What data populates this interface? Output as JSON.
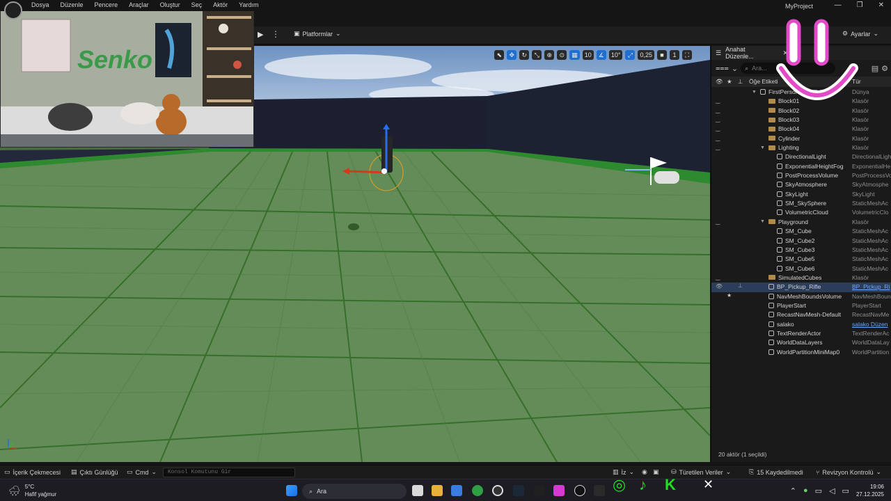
{
  "app": {
    "project_name": "MyProject",
    "window_controls": [
      "—",
      "❐",
      "✕"
    ]
  },
  "menu": {
    "items": [
      "Dosya",
      "Düzenle",
      "Pencere",
      "Araçlar",
      "Oluştur",
      "Seç",
      "Aktör",
      "Yardım"
    ]
  },
  "toolbar": {
    "platforms_label": "Platformlar",
    "settings_label": "Ayarlar"
  },
  "viewport": {
    "grid_snap": "10",
    "rotation_snap": "10°",
    "scale_snap": "0,25",
    "camera_speed": "1"
  },
  "outliner": {
    "tab_title": "Anahat Düzenle...",
    "search_placeholder": "Ara...",
    "header_label": "Öğe Etiketi",
    "header_type": "Tür",
    "rows": [
      {
        "label": "FirstPersonMap (Editör)",
        "type": "Dünya",
        "indent": 0,
        "kind": "world",
        "caret": "▼"
      },
      {
        "label": "Block01",
        "type": "Klasör",
        "indent": 1,
        "kind": "folder",
        "caret": ""
      },
      {
        "label": "Block02",
        "type": "Klasör",
        "indent": 1,
        "kind": "folder",
        "caret": ""
      },
      {
        "label": "Block03",
        "type": "Klasör",
        "indent": 1,
        "kind": "folder",
        "caret": ""
      },
      {
        "label": "Block04",
        "type": "Klasör",
        "indent": 1,
        "kind": "folder",
        "caret": ""
      },
      {
        "label": "Cylinder",
        "type": "Klasör",
        "indent": 1,
        "kind": "folder",
        "caret": ""
      },
      {
        "label": "Lighting",
        "type": "Klasör",
        "indent": 1,
        "kind": "folder",
        "caret": "▼"
      },
      {
        "label": "DirectionalLight",
        "type": "DirectionalLight",
        "indent": 2,
        "kind": "actor",
        "caret": ""
      },
      {
        "label": "ExponentialHeightFog",
        "type": "ExponentialHe",
        "indent": 2,
        "kind": "actor",
        "caret": ""
      },
      {
        "label": "PostProcessVolume",
        "type": "PostProcessVo",
        "indent": 2,
        "kind": "actor",
        "caret": ""
      },
      {
        "label": "SkyAtmosphere",
        "type": "SkyAtmosphe",
        "indent": 2,
        "kind": "actor",
        "caret": ""
      },
      {
        "label": "SkyLight",
        "type": "SkyLight",
        "indent": 2,
        "kind": "actor",
        "caret": ""
      },
      {
        "label": "SM_SkySphere",
        "type": "StaticMeshAc",
        "indent": 2,
        "kind": "actor",
        "caret": ""
      },
      {
        "label": "VolumetricCloud",
        "type": "VolumetricClo",
        "indent": 2,
        "kind": "actor",
        "caret": ""
      },
      {
        "label": "Playground",
        "type": "Klasör",
        "indent": 1,
        "kind": "folder",
        "caret": "▼"
      },
      {
        "label": "SM_Cube",
        "type": "StaticMeshAc",
        "indent": 2,
        "kind": "actor",
        "caret": ""
      },
      {
        "label": "SM_Cube2",
        "type": "StaticMeshAc",
        "indent": 2,
        "kind": "actor",
        "caret": ""
      },
      {
        "label": "SM_Cube3",
        "type": "StaticMeshAc",
        "indent": 2,
        "kind": "actor",
        "caret": ""
      },
      {
        "label": "SM_Cube5",
        "type": "StaticMeshAc",
        "indent": 2,
        "kind": "actor",
        "caret": ""
      },
      {
        "label": "SM_Cube6",
        "type": "StaticMeshAc",
        "indent": 2,
        "kind": "actor",
        "caret": ""
      },
      {
        "label": "SimulatedCubes",
        "type": "Klasör",
        "indent": 1,
        "kind": "folder",
        "caret": ""
      },
      {
        "label": "BP_Pickup_Rifle",
        "type": "BP_Pickup_Ri",
        "indent": 1,
        "kind": "actor",
        "caret": "",
        "selected": true
      },
      {
        "label": "NavMeshBoundsVolume",
        "type": "NavMeshBoun",
        "indent": 1,
        "kind": "actor",
        "caret": ""
      },
      {
        "label": "PlayerStart",
        "type": "PlayerStart",
        "indent": 1,
        "kind": "actor",
        "caret": ""
      },
      {
        "label": "RecastNavMesh-Default",
        "type": "RecastNavMe",
        "indent": 1,
        "kind": "actor",
        "caret": ""
      },
      {
        "label": "salako",
        "type": "salako Düzen",
        "indent": 1,
        "kind": "actor",
        "caret": "",
        "link": true
      },
      {
        "label": "TextRenderActor",
        "type": "TextRenderAc",
        "indent": 1,
        "kind": "actor",
        "caret": ""
      },
      {
        "label": "WorldDataLayers",
        "type": "WorldDataLay",
        "indent": 1,
        "kind": "actor",
        "caret": ""
      },
      {
        "label": "WorldPartitionMiniMap0",
        "type": "WorldPartition",
        "indent": 1,
        "kind": "actor",
        "caret": ""
      }
    ],
    "footer": "20 aktör (1 seçildi)"
  },
  "bottom_bar": {
    "content_drawer": "İçerik Çekmecesi",
    "output_log": "Çıktı Günlüğü",
    "cmd": "Cmd",
    "console_placeholder": "Konsol Komutunu Gir",
    "trace": "İz",
    "derived_data": "Türetilen Veriler",
    "unsaved": "15 Kaydedilmedi",
    "revision": "Revizyon Kontrolü"
  },
  "taskbar": {
    "temperature": "5°C",
    "weather": "Hafif yağmur",
    "search_label": "Ara",
    "time": "19:06",
    "date": "27.12.2025"
  },
  "webcam": {
    "wall_text": "Senko"
  }
}
